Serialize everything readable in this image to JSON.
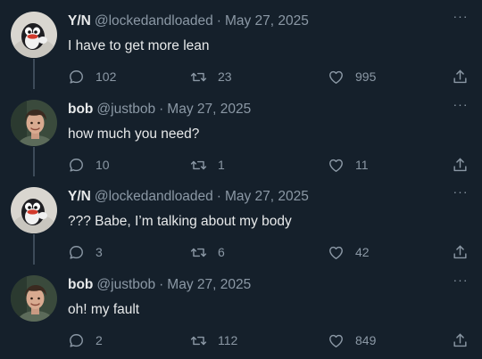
{
  "thread": [
    {
      "author": {
        "name": "Y/N",
        "handle": "@lockedandloaded",
        "avatar": "penguin-avatar"
      },
      "date": "May 27, 2025",
      "text": "I have to get more lean",
      "stats": {
        "replies": "102",
        "retweets": "23",
        "likes": "995"
      }
    },
    {
      "author": {
        "name": "bob",
        "handle": "@justbob",
        "avatar": "person-avatar"
      },
      "date": "May 27, 2025",
      "text": "how much you need?",
      "stats": {
        "replies": "10",
        "retweets": "1",
        "likes": "11"
      }
    },
    {
      "author": {
        "name": "Y/N",
        "handle": "@lockedandloaded",
        "avatar": "penguin-avatar"
      },
      "date": "May 27, 2025",
      "text": "??? Babe, I’m talking about my body",
      "stats": {
        "replies": "3",
        "retweets": "6",
        "likes": "42"
      }
    },
    {
      "author": {
        "name": "bob",
        "handle": "@justbob",
        "avatar": "person-avatar"
      },
      "date": "May 27, 2025",
      "text": "oh! my fault",
      "stats": {
        "replies": "2",
        "retweets": "112",
        "likes": "849"
      }
    }
  ],
  "ui": {
    "separator": "·",
    "more_glyph": "···",
    "colors": {
      "background": "#15202b",
      "text": "#e7e9ea",
      "secondary": "#8b98a5",
      "thread_line": "#3d4b59"
    },
    "icons": [
      "reply-icon",
      "retweet-icon",
      "like-icon",
      "share-icon",
      "more-icon"
    ]
  }
}
